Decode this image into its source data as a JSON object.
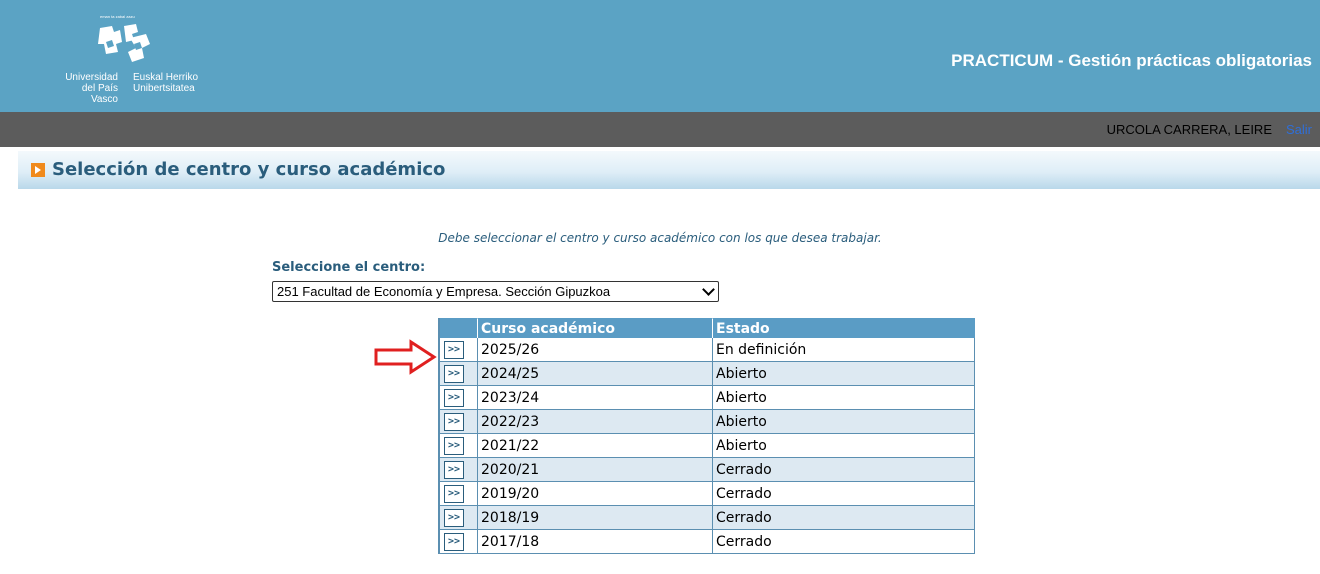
{
  "header": {
    "logo": {
      "tagline": "eman ta zabal zazu",
      "name_es_line1": "Universidad",
      "name_es_line2": "del País Vasco",
      "name_eu_line1": "Euskal Herriko",
      "name_eu_line2": "Unibertsitatea"
    },
    "app_title": "PRACTICUM - Gestión prácticas obligatorias",
    "colors": {
      "header_bg": "#5ba3c4",
      "userbar_bg": "#5c5c5c",
      "accent": "#2a5d7c"
    }
  },
  "userbar": {
    "user_name": "URCOLA CARRERA, LEIRE",
    "logout_label": "Salir"
  },
  "section": {
    "title": "Selección de centro y curso académico",
    "icon": "chevron-right-icon"
  },
  "form": {
    "instruction": "Debe seleccionar el centro y curso académico con los que desea trabajar.",
    "center_label": "Seleccione el centro:",
    "center_selected": "251 Facultad de Economía y Empresa. Sección Gipuzkoa"
  },
  "table": {
    "headers": {
      "button": "",
      "year": "Curso académico",
      "state": "Estado"
    },
    "button_label": ">>",
    "rows": [
      {
        "year": "2025/26",
        "state": "En definición"
      },
      {
        "year": "2024/25",
        "state": "Abierto"
      },
      {
        "year": "2023/24",
        "state": "Abierto"
      },
      {
        "year": "2022/23",
        "state": "Abierto"
      },
      {
        "year": "2021/22",
        "state": "Abierto"
      },
      {
        "year": "2020/21",
        "state": "Cerrado"
      },
      {
        "year": "2019/20",
        "state": "Cerrado"
      },
      {
        "year": "2018/19",
        "state": "Cerrado"
      },
      {
        "year": "2017/18",
        "state": "Cerrado"
      }
    ]
  },
  "annotation": {
    "icon": "red-arrow-right-icon",
    "color": "#e02020"
  }
}
